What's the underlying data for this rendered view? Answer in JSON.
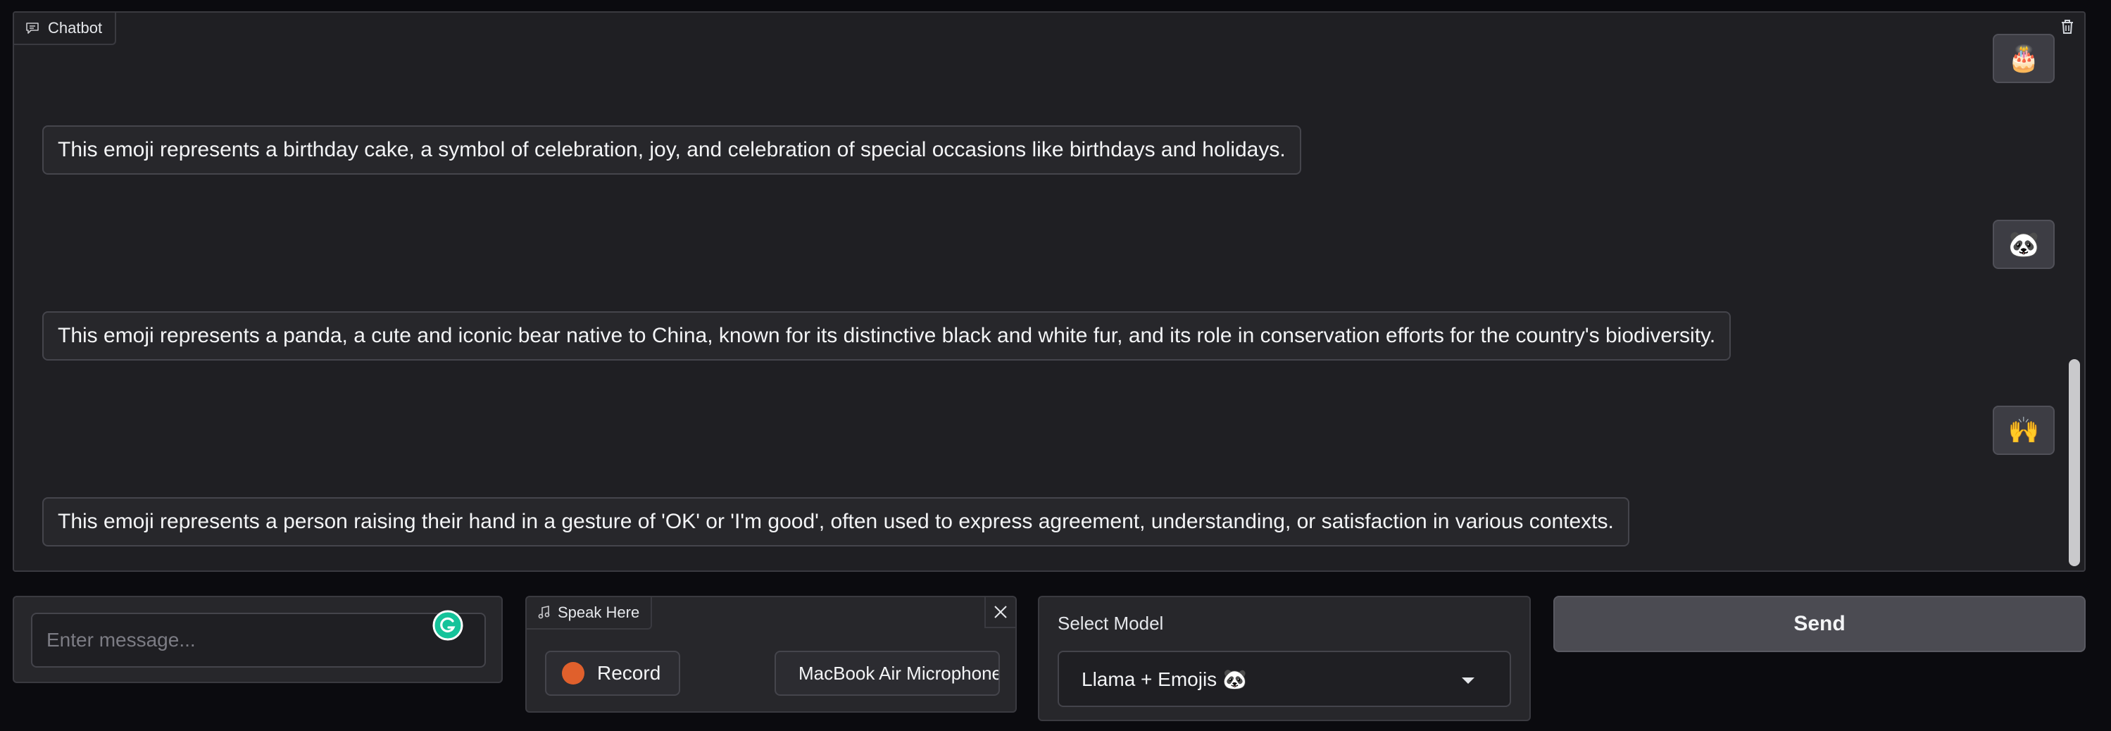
{
  "chatbot": {
    "label": "Chatbot",
    "messages": [
      {
        "role": "user",
        "content": "🎂"
      },
      {
        "role": "bot",
        "content": "This emoji represents a birthday cake, a symbol of celebration, joy, and celebration of special occasions like birthdays and holidays."
      },
      {
        "role": "user",
        "content": "🐼"
      },
      {
        "role": "bot",
        "content": "This emoji represents a panda, a cute and iconic bear native to China, known for its distinctive black and white fur, and its role in conservation efforts for the country's biodiversity."
      },
      {
        "role": "user",
        "content": "🙌"
      },
      {
        "role": "bot",
        "content": "This emoji represents a person raising their hand in a gesture of 'OK' or 'I'm good', often used to express agreement, understanding, or satisfaction in various contexts."
      }
    ]
  },
  "message_input": {
    "placeholder": "Enter message...",
    "value": ""
  },
  "speak": {
    "label": "Speak Here",
    "record_label": "Record",
    "microphone": "MacBook Air Microphone"
  },
  "model": {
    "label": "Select Model",
    "selected": "Llama + Emojis 🐼"
  },
  "send": {
    "label": "Send"
  },
  "icons": {
    "chatbot_label": "chat-bubble-icon",
    "clear": "trash-icon",
    "speak_label": "music-note-icon",
    "close": "close-icon",
    "dropdown": "caret-down-icon",
    "grammarly": "grammarly-icon"
  },
  "colors": {
    "record_dot": "#e0602c",
    "send_button": "#4b4b52"
  }
}
